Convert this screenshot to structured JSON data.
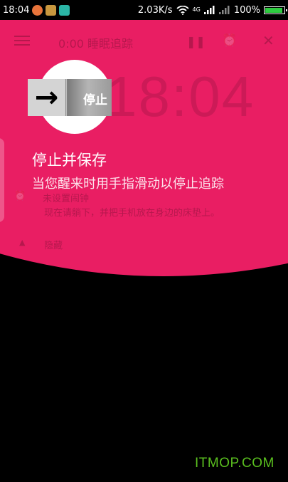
{
  "status_bar": {
    "time": "18:04",
    "speed": "2.03K/s",
    "net_type": "4G",
    "battery": "100%",
    "app_icons": [
      "#e8743b",
      "#c8973e",
      "#2bb5a6"
    ]
  },
  "toolbar": {
    "title": "0:00 睡眠追踪",
    "pause_icon": "pause-icon",
    "alarm_icon": "alarm-icon",
    "close_icon": "close-icon"
  },
  "background": {
    "clock": "18:04",
    "line1": "未设置闹钟",
    "line2": "现在请躺下，并把手机放在身边的床垫上。",
    "line3": "隐藏"
  },
  "stop_slider": {
    "arrow": "→",
    "label": "停止"
  },
  "tutorial": {
    "title": "停止并保存",
    "description": "当您醒来时用手指滑动以停止追踪"
  },
  "colors": {
    "accent": "#e91e63",
    "watermark": "#5abf1f"
  },
  "watermark": "ITMOP.COM"
}
